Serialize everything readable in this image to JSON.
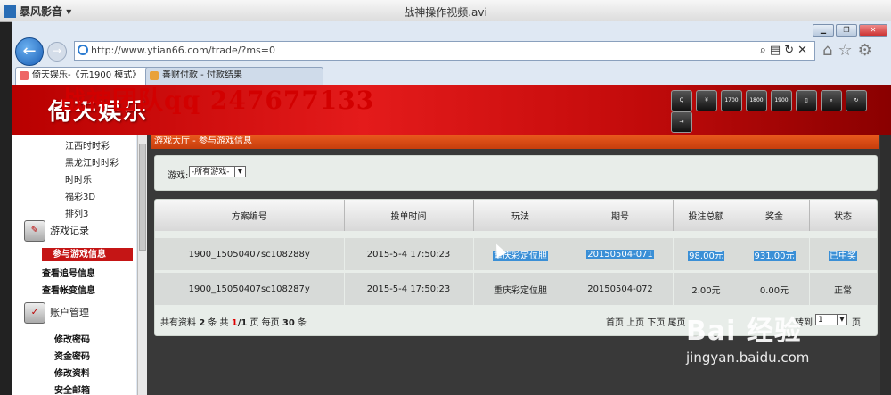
{
  "player": {
    "app_name": "暴风影音",
    "video_title": "战神操作视频.avi"
  },
  "browser": {
    "url": "http://www.ytian66.com/trade/?ms=0",
    "tabs": [
      {
        "label": "倚天娱乐-《元1900 模式》"
      },
      {
        "label": "善财付款 - 付款结果"
      }
    ]
  },
  "site": {
    "brand": "倚天娱乐",
    "watermark": "战神团队qq 247677133",
    "header_icons": [
      "qq-icon",
      "yuan-icon",
      "1700-icon",
      "1800-icon",
      "1900-icon",
      "book-icon",
      "search-icon",
      "refresh-icon",
      "exit-icon"
    ],
    "header_icon_labels": [
      "",
      "",
      "1700",
      "1800",
      "1900",
      "",
      "",
      "",
      ""
    ]
  },
  "sidebar": {
    "sub_items_top": [
      "江西时时彩",
      "黑龙江时时彩",
      "时时乐",
      "福彩3D",
      "排列3"
    ],
    "sections": [
      {
        "label": "游戏记录",
        "items": [
          "参与游戏信息",
          "查看追号信息",
          "查看帐变信息"
        ]
      },
      {
        "label": "账户管理",
        "items": [
          "修改密码",
          "资金密码",
          "修改资料",
          "安全邮箱"
        ]
      }
    ]
  },
  "main": {
    "page_title": "游戏大厅 - 参与游戏信息",
    "filter": {
      "label": "游戏:",
      "selected": "-所有游戏-"
    },
    "table": {
      "headers": [
        "方案编号",
        "投单时间",
        "玩法",
        "期号",
        "投注总额",
        "奖金",
        "状态"
      ],
      "rows": [
        [
          "1900_15050407sc108288y",
          "2015-5-4 17:50:23",
          "重庆彩定位胆",
          "20150504-071",
          "98.00元",
          "931.00元",
          "已中奖"
        ],
        [
          "1900_15050407sc108287y",
          "2015-5-4 17:50:23",
          "重庆彩定位胆",
          "20150504-072",
          "2.00元",
          "0.00元",
          "正常"
        ]
      ]
    },
    "pager": {
      "total_prefix": "共有资料",
      "total_count": "2",
      "total_mid": "条 共",
      "page_current": "1",
      "page_total": "/1",
      "page_suffix": "页 每页",
      "per_page": "30",
      "per_page_unit": "条",
      "nav_links": [
        "首页",
        "上页",
        "下页",
        "尾页"
      ],
      "goto_label": "转到",
      "goto_value": "1",
      "goto_unit": "页"
    }
  },
  "overlay": {
    "baidu_logo": "Bai 经验",
    "baidu_url": "jingyan.baidu.com"
  }
}
